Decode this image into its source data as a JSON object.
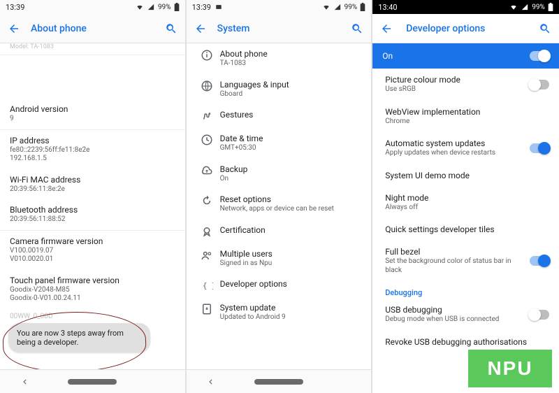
{
  "watermark": "NPU",
  "panel1": {
    "clock": "13:39",
    "battery": "99%",
    "title": "About phone",
    "model_clip": "Model: TA-1083",
    "rows": [
      {
        "title": "Android version",
        "sub": "9"
      },
      {
        "title": "IP address",
        "sub": "fe80::2239:56ff:fe11:8e2e\n192.168.1.5"
      },
      {
        "title": "Wi-Fi MAC address",
        "sub": "20:39:56:11:8e:2e"
      },
      {
        "title": "Bluetooth address",
        "sub": "20:39:56:11:88:52"
      },
      {
        "title": "Camera firmware version",
        "sub": "V100.0019.07\nV010.0020.01"
      },
      {
        "title": "Touch panel firmware version",
        "sub": "Goodix-V2048-M85\nGoodix-0-V01.00.24.11"
      }
    ],
    "hidden_tail": "00WW_0_00D",
    "toast": "You are now 3 steps away from being a developer."
  },
  "panel2": {
    "clock": "13:39",
    "battery": "99%",
    "title": "System",
    "items": [
      {
        "icon": "info",
        "title": "About phone",
        "sub": "TA-1083"
      },
      {
        "icon": "globe",
        "title": "Languages & input",
        "sub": "Gboard"
      },
      {
        "icon": "gesture",
        "title": "Gestures",
        "sub": ""
      },
      {
        "icon": "clock",
        "title": "Date & time",
        "sub": "GMT+05:30"
      },
      {
        "icon": "cloud",
        "title": "Backup",
        "sub": "On"
      },
      {
        "icon": "reset",
        "title": "Reset options",
        "sub": "Network, apps or device can be reset"
      },
      {
        "icon": "cert",
        "title": "Certification",
        "sub": ""
      },
      {
        "icon": "users",
        "title": "Multiple users",
        "sub": "Signed in as Npu"
      },
      {
        "icon": "dev",
        "title": "Developer options",
        "sub": ""
      },
      {
        "icon": "update",
        "title": "System update",
        "sub": "Updated to Android 9"
      }
    ]
  },
  "panel3": {
    "clock": "13:40",
    "battery": "99%",
    "title": "Developer options",
    "on_label": "On",
    "rows": [
      {
        "title": "Picture colour mode",
        "sub": "Use sRGB",
        "switch": "off"
      },
      {
        "title": "WebView implementation",
        "sub": "Chrome"
      },
      {
        "title": "Automatic system updates",
        "sub": "Apply updates when device restarts",
        "switch": "on"
      },
      {
        "title": "System UI demo mode",
        "sub": ""
      },
      {
        "title": "Night mode",
        "sub": "Always off"
      },
      {
        "title": "Quick settings developer tiles",
        "sub": ""
      },
      {
        "title": "Full bezel",
        "sub": "Set the background color of status bar in black",
        "switch": "on"
      }
    ],
    "section": "Debugging",
    "debug_rows": [
      {
        "title": "USB debugging",
        "sub": "Debug mode when USB is connected",
        "switch": "off"
      },
      {
        "title": "Revoke USB debugging authorisations",
        "sub": ""
      }
    ]
  }
}
